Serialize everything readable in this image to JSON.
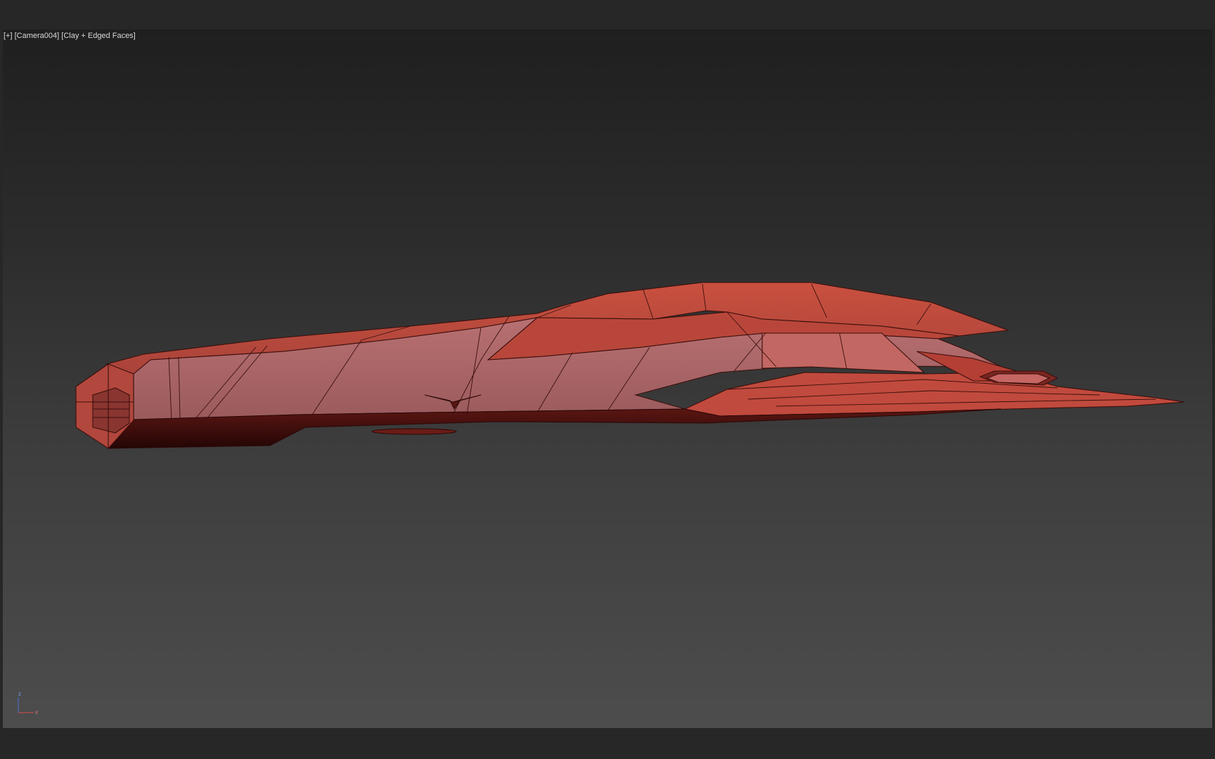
{
  "viewport": {
    "label_menu": "[+]",
    "label_camera": "[Camera004]",
    "label_shading": "[Clay + Edged Faces]",
    "model_color": "#c24a3e",
    "edge_color": "#3a0f0b",
    "background_top": "#1f1f1f",
    "background_bottom": "#4d4d4d"
  },
  "axis_gizmo": {
    "z_label": "z",
    "x_label": "x",
    "z_color": "#4a6fd8",
    "x_color": "#d84a4a"
  }
}
